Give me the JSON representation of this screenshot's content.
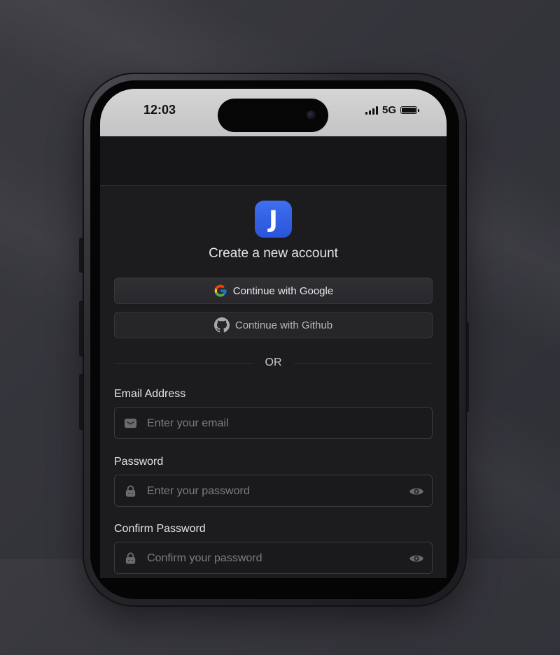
{
  "status_bar": {
    "time": "12:03",
    "network": "5G",
    "icons": [
      "signal-icon",
      "battery-icon"
    ]
  },
  "app": {
    "logo_letter": "J",
    "title": "Create a new account",
    "oauth": {
      "google_label": "Continue with Google",
      "github_label": "Continue with Github"
    },
    "divider_text": "OR",
    "form": {
      "email_label": "Email Address",
      "email_placeholder": "Enter your email",
      "password_label": "Password",
      "password_placeholder": "Enter your password",
      "confirm_label": "Confirm Password",
      "confirm_placeholder": "Confirm your password"
    }
  },
  "colors": {
    "background": "#34343b",
    "screen": "#1c1c1f",
    "accent": "#2f5fe6",
    "field_border": "#3a3a3f",
    "placeholder": "#7c7c82"
  }
}
